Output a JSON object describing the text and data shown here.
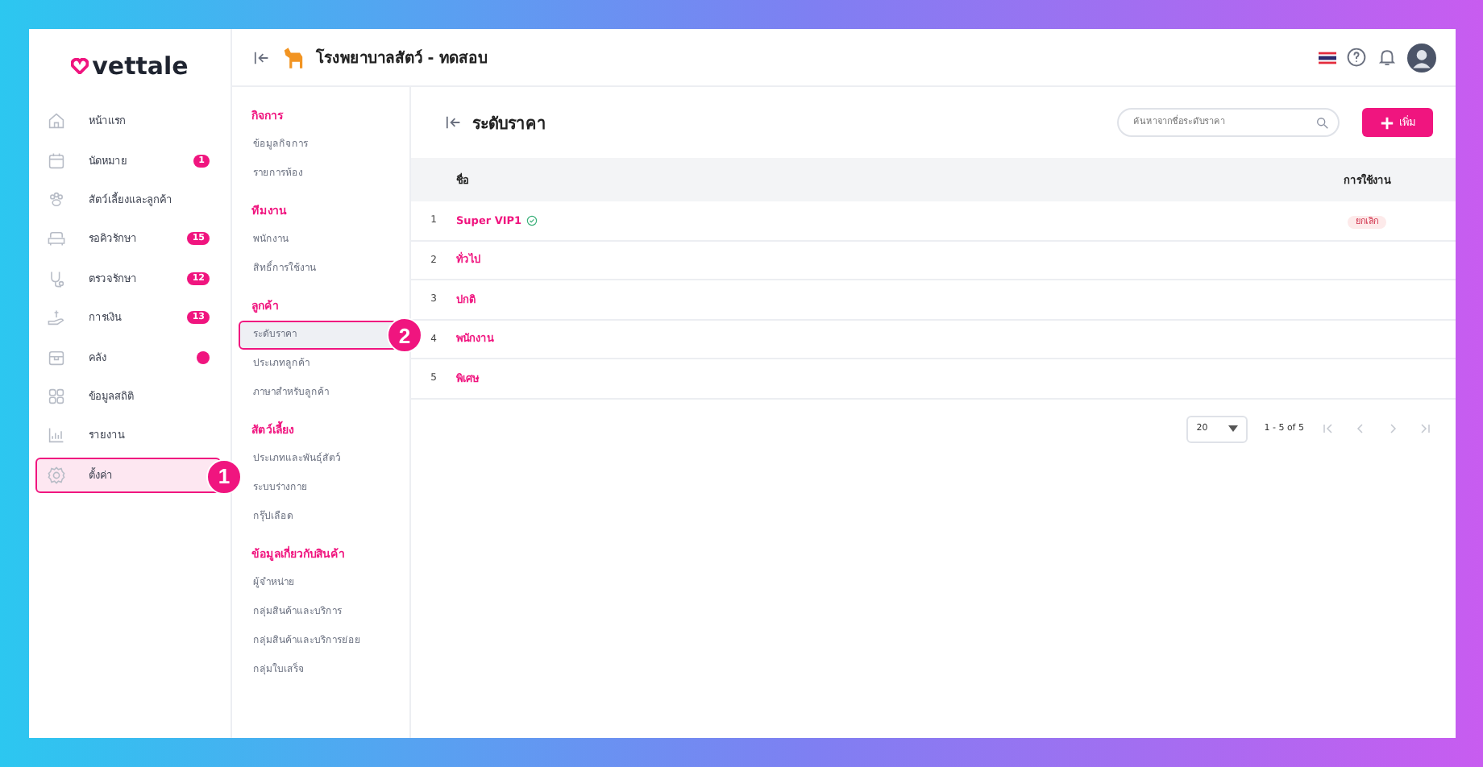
{
  "logo": {
    "text": "vettale"
  },
  "sidebar": {
    "items": [
      {
        "label": "หน้าแรก",
        "selected": false
      },
      {
        "label": "นัดหมาย",
        "badge": "1",
        "selected": false
      },
      {
        "label": "สัตว์เลี้ยงและลูกค้า",
        "selected": false
      },
      {
        "label": "รอคิวรักษา",
        "badge": "15",
        "selected": false
      },
      {
        "label": "ตรวจรักษา",
        "badge": "12",
        "selected": false
      },
      {
        "label": "การเงิน",
        "badge": "13",
        "selected": false
      },
      {
        "label": "คลัง",
        "dot": true,
        "selected": false
      },
      {
        "label": "ข้อมูลสถิติ",
        "selected": false
      },
      {
        "label": "รายงาน",
        "selected": false
      },
      {
        "label": "ตั้งค่า",
        "selected": true,
        "callout": "1"
      }
    ]
  },
  "header": {
    "title": "โรงพยาบาลสัตว์ - ทดสอบ"
  },
  "settings_nav": {
    "sections": [
      {
        "title": "กิจการ",
        "items": [
          {
            "label": "ข้อมูลกิจการ",
            "selected": false
          },
          {
            "label": "รายการห้อง",
            "selected": false
          }
        ]
      },
      {
        "title": "ทีมงาน",
        "items": [
          {
            "label": "พนักงาน",
            "selected": false
          },
          {
            "label": "สิทธิ์การใช้งาน",
            "selected": false
          }
        ]
      },
      {
        "title": "ลูกค้า",
        "items": [
          {
            "label": "ระดับราคา",
            "selected": true,
            "callout": "2"
          },
          {
            "label": "ประเภทลูกค้า",
            "selected": false
          },
          {
            "label": "ภาษาสำหรับลูกค้า",
            "selected": false
          }
        ]
      },
      {
        "title": "สัตว์เลี้ยง",
        "items": [
          {
            "label": "ประเภทและพันธุ์สัตว์",
            "selected": false
          },
          {
            "label": "ระบบร่างกาย",
            "selected": false
          },
          {
            "label": "กรุ๊ปเลือด",
            "selected": false
          }
        ]
      },
      {
        "title": "ข้อมูลเกี่ยวกับสินค้า",
        "items": [
          {
            "label": "ผู้จำหน่าย",
            "selected": false
          },
          {
            "label": "กลุ่มสินค้าและบริการ",
            "selected": false
          },
          {
            "label": "กลุ่มสินค้าและบริการย่อย",
            "selected": false
          },
          {
            "label": "กลุ่มใบเสร็จ",
            "selected": false
          }
        ]
      }
    ]
  },
  "page": {
    "title": "ระดับราคา",
    "search": {
      "placeholder": "ค้นหาจากชื่อระดับราคา"
    },
    "add_button": "เพิ่ม"
  },
  "table": {
    "columns": [
      "ชื่อ",
      "การใช้งาน"
    ],
    "rows": [
      {
        "index": "1",
        "name": "Super VIP1",
        "verified": true,
        "status": "ยกเลิก"
      },
      {
        "index": "2",
        "name": "ทั่วไป",
        "verified": false
      },
      {
        "index": "3",
        "name": "ปกติ",
        "verified": false
      },
      {
        "index": "4",
        "name": "พนักงาน",
        "verified": false
      },
      {
        "index": "5",
        "name": "พิเศษ",
        "verified": false
      }
    ]
  },
  "pagination": {
    "page_size": "20",
    "range": "1 - 5 of 5"
  }
}
